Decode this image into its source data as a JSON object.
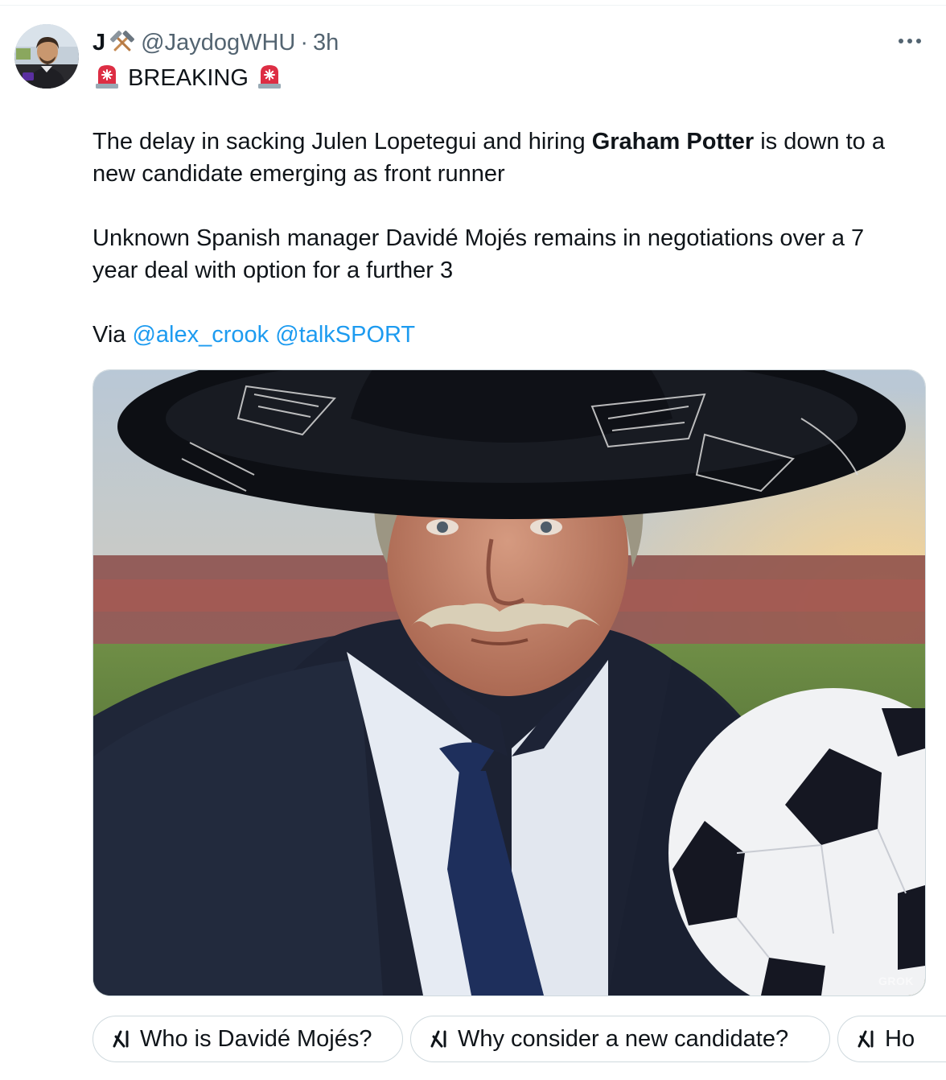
{
  "tweet": {
    "display_name": "J",
    "handle": "@JaydogWHU",
    "separator": "·",
    "time": "3h",
    "breaking_label": "BREAKING",
    "para1_line1_a": "The delay in sacking Julen Lopetegui and hiring ",
    "para1_bold": "Graham Potter",
    "para1_line1_b": " is down to a",
    "para1_line2": "new candidate emerging as front runner",
    "para2_line1": "Unknown Spanish manager Davidé Mojés remains in negotiations over a 7",
    "para2_line2": "year deal with option for a further 3",
    "via_label": "Via ",
    "mention1": "@alex_crook",
    "mention2": "@talkSPORT",
    "media_watermark": "GROK"
  },
  "grok_chips": [
    {
      "label": "Who is Davidé Mojés?"
    },
    {
      "label": "Why consider a new candidate?"
    },
    {
      "label": "Ho"
    }
  ],
  "icons": {
    "hammer": "crossed-hammers-icon",
    "siren": "rotating-light-icon",
    "more": "more-icon",
    "grok": "grok-icon"
  },
  "colors": {
    "text": "#0f1419",
    "secondary": "#536471",
    "link": "#1d9bf0",
    "border": "#cfd9de"
  }
}
